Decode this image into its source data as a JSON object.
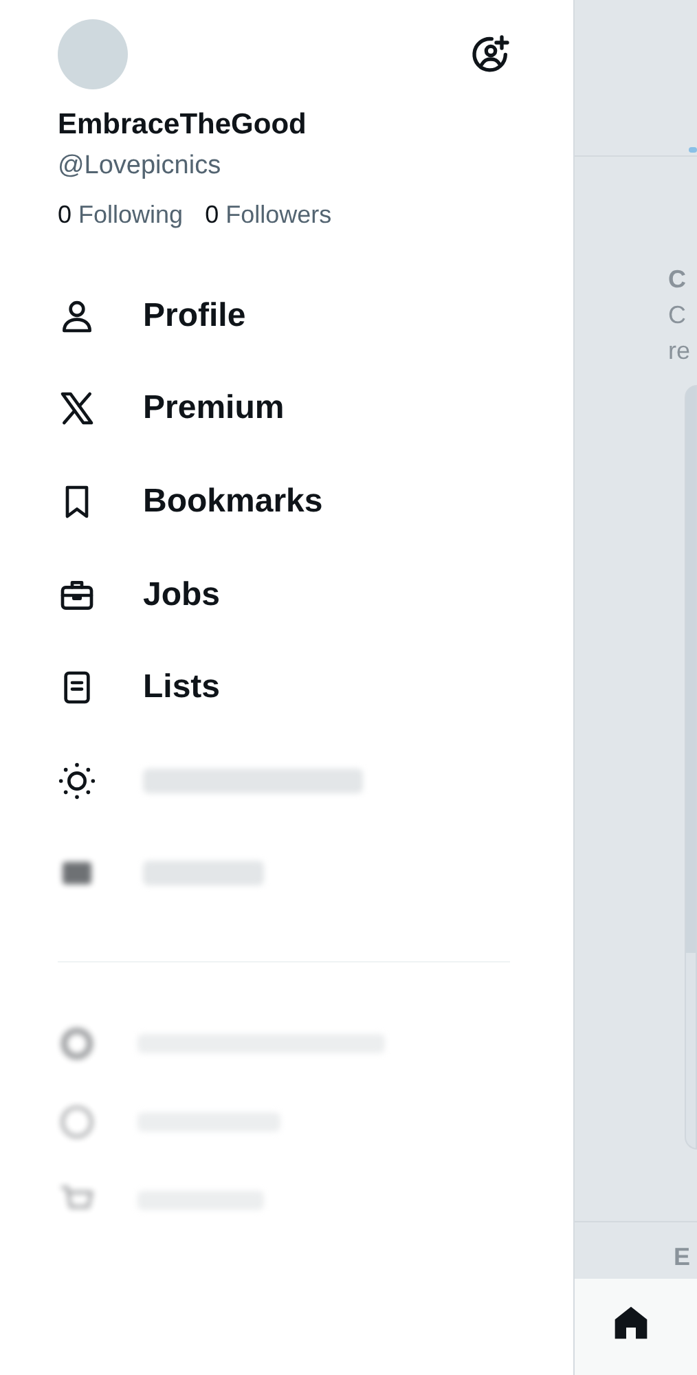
{
  "drawer": {
    "name": "EmbraceTheGood",
    "handle": "@Lovepicnics",
    "stats": [
      {
        "count": "0",
        "label": "Following"
      },
      {
        "count": "0",
        "label": "Followers"
      }
    ],
    "menu": [
      {
        "kind": "person",
        "label": "Profile",
        "blurred": false
      },
      {
        "kind": "x",
        "label": "Premium",
        "blurred": false
      },
      {
        "kind": "bookmark",
        "label": "Bookmarks",
        "blurred": false
      },
      {
        "kind": "briefcase",
        "label": "Jobs",
        "blurred": false
      },
      {
        "kind": "list",
        "label": "Lists",
        "blurred": false
      },
      {
        "kind": "spaces",
        "blurred": true
      },
      {
        "kind": "money",
        "blurred": true
      }
    ],
    "secondary": [
      {
        "kind": "gear",
        "blurred": true
      },
      {
        "kind": "help",
        "blurred": true
      },
      {
        "kind": "cart",
        "blurred": true
      }
    ]
  },
  "background": {
    "tab_fragment_selected": true,
    "title_fragment": "C",
    "body_fragments": [
      "C",
      "re"
    ],
    "section_fragment": "E"
  }
}
